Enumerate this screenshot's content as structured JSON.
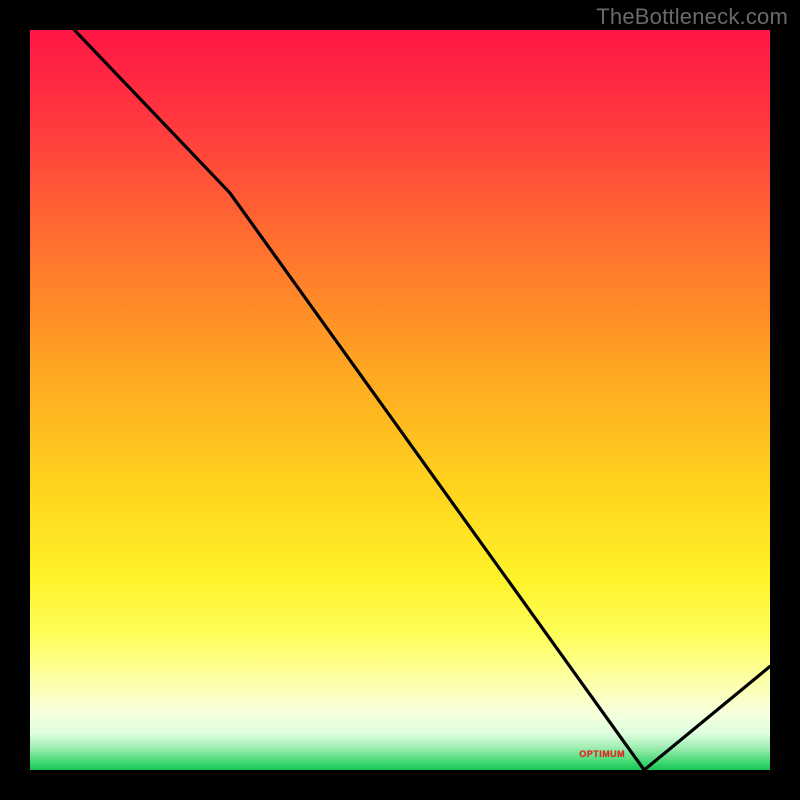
{
  "attribution": "TheBottleneck.com",
  "marker_label": "OPTIMUM",
  "colors": {
    "frame": "#000000",
    "curve": "#000000",
    "top_gradient": "#ff1645",
    "bottom_gradient": "#18c455",
    "attribution_text": "#6a6a6a",
    "marker_text": "#ff1a1a"
  },
  "chart_data": {
    "type": "line",
    "title": "",
    "xlabel": "",
    "ylabel": "",
    "xlim": [
      0,
      100
    ],
    "ylim": [
      0,
      100
    ],
    "grid": false,
    "legend": false,
    "notes": "x ≈ normalized component strength (left→right), y ≈ bottleneck severity (top=100% severe red, bottom=0% green). Curve descends from top-left, has slight bend ~x=27, reaches minimum ~x=83, then rises toward right edge. Optimum marker sits on the green band slightly left of the minimum.",
    "series": [
      {
        "name": "bottleneck-curve",
        "points": [
          {
            "x": 6,
            "y": 100
          },
          {
            "x": 27,
            "y": 78
          },
          {
            "x": 83,
            "y": 0
          },
          {
            "x": 100,
            "y": 14
          }
        ]
      }
    ],
    "marker": {
      "x": 78,
      "y": 1.5,
      "label": "OPTIMUM"
    }
  }
}
